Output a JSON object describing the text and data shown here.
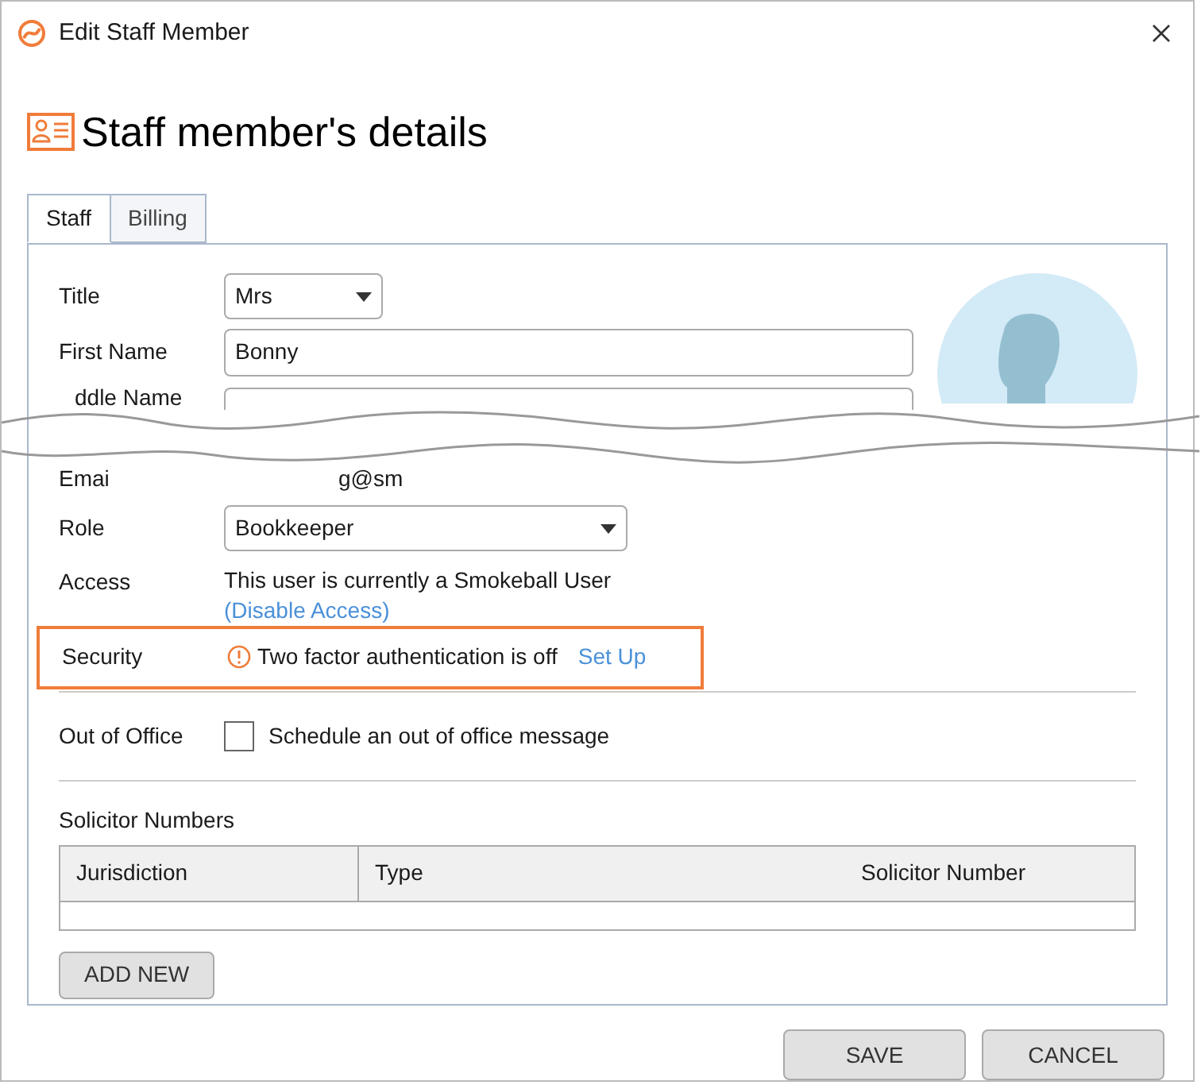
{
  "window": {
    "title": "Edit Staff Member"
  },
  "heading": "Staff member's details",
  "tabs": [
    {
      "label": "Staff",
      "selected": true
    },
    {
      "label": "Billing",
      "selected": false
    }
  ],
  "fields_top": [
    {
      "label": "Title",
      "kind": "select",
      "value": "Mrs"
    },
    {
      "label": "First Name",
      "kind": "text",
      "value": "Bonny"
    },
    {
      "label": "ddle Name",
      "kind": "text_cut"
    }
  ],
  "email": {
    "label": "Emai",
    "value": "g@sm"
  },
  "role": {
    "label": "Role",
    "value": "Bookkeeper"
  },
  "access": {
    "label": "Access",
    "text": "This user is currently a Smokeball User",
    "link": "(Disable Access)"
  },
  "security": {
    "label": "Security",
    "text": "Two factor authentication is off",
    "link": "Set Up",
    "highlighted": true
  },
  "out_of_office": {
    "label": "Out of Office",
    "checkbox_label": "Schedule an out of office message",
    "checked": false
  },
  "solicitor_numbers": {
    "title": "Solicitor Numbers",
    "columns": [
      "Jurisdiction",
      "Type",
      "Solicitor Number"
    ],
    "add_button": "ADD NEW"
  },
  "buttons": [
    "SAVE",
    "CANCEL"
  ]
}
